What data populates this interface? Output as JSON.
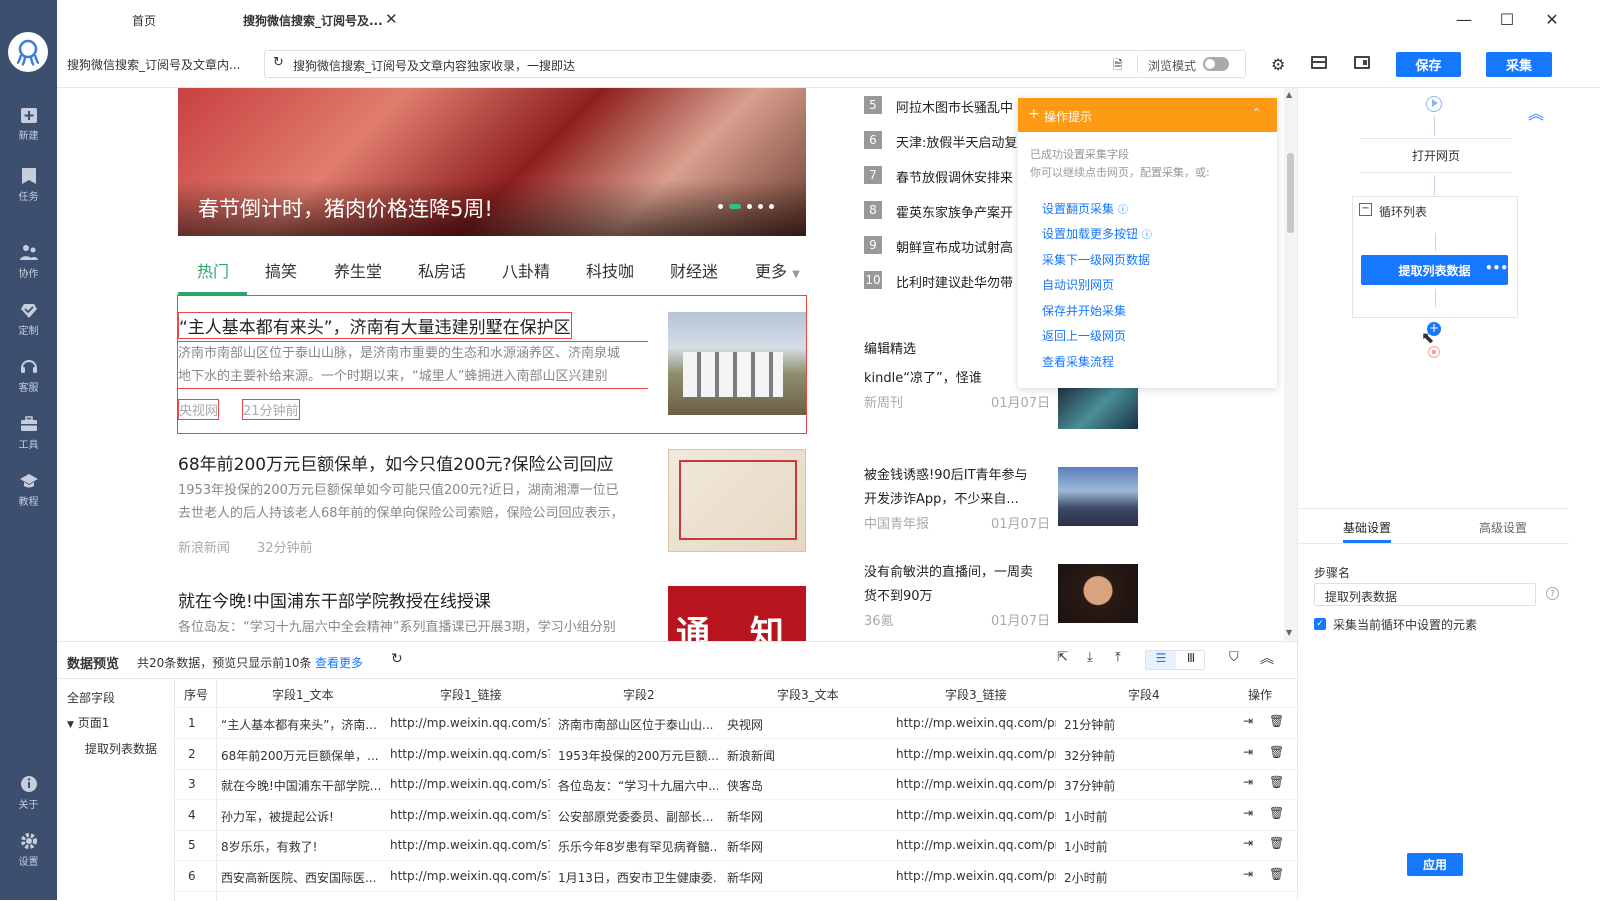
{
  "sidebar": {
    "items": [
      {
        "label": "新建",
        "icon": "new-task-icon"
      },
      {
        "label": "任务",
        "icon": "task-icon"
      },
      {
        "label": "协作",
        "icon": "collab-icon"
      },
      {
        "label": "定制",
        "icon": "custom-icon"
      },
      {
        "label": "客服",
        "icon": "headset-icon"
      },
      {
        "label": "工具",
        "icon": "toolbox-icon"
      },
      {
        "label": "教程",
        "icon": "tutorial-icon"
      }
    ],
    "bottom": [
      {
        "label": "关于",
        "icon": "info-icon"
      },
      {
        "label": "设置",
        "icon": "gear-icon"
      }
    ]
  },
  "tabs": [
    {
      "label": "首页"
    },
    {
      "label": "搜狗微信搜索_订阅号及..."
    }
  ],
  "toolbar": {
    "page_name": "搜狗微信搜索_订阅号及文章内...",
    "url": "搜狗微信搜索_订阅号及文章内容独家收录，一搜即达",
    "browse_mode_label": "浏览模式",
    "save_label": "保存",
    "collect_label": "采集"
  },
  "webpage": {
    "banner_caption": "春节倒计时，猪肉价格连降5周!",
    "nav_tabs": [
      "热门",
      "搞笑",
      "养生堂",
      "私房话",
      "八卦精",
      "科技咖",
      "财经迷",
      "更多"
    ],
    "articles": [
      {
        "title": "“主人基本都有来头”，济南有大量违建别墅在保护区",
        "desc1": "济南市南部山区位于泰山山脉，是济南市重要的生态和水源涵养区、济南泉城",
        "desc2": "地下水的主要补给来源。一个时期以来，“城里人”蜂拥进入南部山区兴建别",
        "source": "央视网",
        "time": "21分钟前"
      },
      {
        "title": "68年前200万元巨额保单，如今只值200元?保险公司回应",
        "desc1": "1953年投保的200万元巨额保单如今可能只值200元?近日，湖南湘潭一位已",
        "desc2": "去世老人的后人持该老人68年前的保单向保险公司索赔，保险公司回应表示，",
        "source": "新浪新闻",
        "time": "32分钟前"
      },
      {
        "title": "就在今晚!中国浦东干部学院教授在线授课",
        "desc1": "各位岛友：“学习十九届六中全会精神”系列直播课已开展3期，学习小组分别",
        "desc2": "",
        "source": "",
        "time": ""
      }
    ],
    "notice_image_text": "通 知",
    "ranking": [
      {
        "num": "5",
        "text": "阿拉木图市长骚乱中"
      },
      {
        "num": "6",
        "text": "天津:放假半天启动复"
      },
      {
        "num": "7",
        "text": "春节放假调休安排来"
      },
      {
        "num": "8",
        "text": "霍英东家族争产案开"
      },
      {
        "num": "9",
        "text": "朝鲜宣布成功试射高"
      },
      {
        "num": "10",
        "text": "比利时建议赴华勿带"
      }
    ],
    "editor_pick_title": "编辑精选",
    "picks": [
      {
        "title1": "kindle“凉了”，怪谁",
        "title2": "",
        "source": "新周刊",
        "date": "01月07日"
      },
      {
        "title1": "被金钱诱惑!90后IT青年参与",
        "title2": "开发涉诈App，不少来自...",
        "source": "中国青年报",
        "date": "01月07日"
      },
      {
        "title1": "没有俞敏洪的直播间，一周卖",
        "title2": "货不到90万",
        "source": "36氪",
        "date": "01月07日"
      }
    ]
  },
  "tip": {
    "title": "操作提示",
    "line1": "已成功设置采集字段",
    "line2": "你可以继续点击网页，配置采集，或:",
    "links": [
      "设置翻页采集",
      "设置加载更多按钮",
      "采集下一级网页数据",
      "自动识别网页",
      "保存并开始采集",
      "返回上一级网页",
      "查看采集流程"
    ]
  },
  "flow": {
    "open_page": "打开网页",
    "loop_list": "循环列表",
    "extract": "提取列表数据"
  },
  "props": {
    "tab_basic": "基础设置",
    "tab_advanced": "高级设置",
    "step_name_label": "步骤名",
    "step_name_value": "提取列表数据",
    "checkbox_label": "采集当前循环中设置的元素",
    "apply_label": "应用"
  },
  "preview": {
    "title": "数据预览",
    "summary": "共20条数据，预览只显示前10条",
    "more": "查看更多",
    "tree_all": "全部字段",
    "tree_page": "页面1",
    "tree_extract": "提取列表数据",
    "columns": [
      "序号",
      "字段1_文本",
      "字段1_链接",
      "字段2",
      "字段3_文本",
      "字段3_链接",
      "字段4",
      "操作"
    ],
    "rows": [
      [
        "1",
        "“主人基本都有来头”，济南...",
        "http://mp.weixin.qq.com/s?s...",
        "济南市南部山区位于泰山山...",
        "央视网",
        "http://mp.weixin.qq.com/pro...",
        "21分钟前"
      ],
      [
        "2",
        "68年前200万元巨额保单，...",
        "http://mp.weixin.qq.com/s?s...",
        "1953年投保的200万元巨额...",
        "新浪新闻",
        "http://mp.weixin.qq.com/pro...",
        "32分钟前"
      ],
      [
        "3",
        "就在今晚!中国浦东干部学院...",
        "http://mp.weixin.qq.com/s?s...",
        "各位岛友：“学习十九届六中...",
        "侠客岛",
        "http://mp.weixin.qq.com/pro...",
        "37分钟前"
      ],
      [
        "4",
        "孙力军，被提起公诉!",
        "http://mp.weixin.qq.com/s?s...",
        "公安部原党委委员、副部长...",
        "新华网",
        "http://mp.weixin.qq.com/pro...",
        "1小时前"
      ],
      [
        "5",
        "8岁乐乐，有救了!",
        "http://mp.weixin.qq.com/s?s...",
        "乐乐今年8岁患有罕见病脊髓...",
        "新华网",
        "http://mp.weixin.qq.com/pro...",
        "1小时前"
      ],
      [
        "6",
        "西安高新医院、西安国际医...",
        "http://mp.weixin.qq.com/s?s...",
        "1月13日，西安市卫生健康委...",
        "新华网",
        "http://mp.weixin.qq.com/pro...",
        "2小时前"
      ]
    ]
  }
}
